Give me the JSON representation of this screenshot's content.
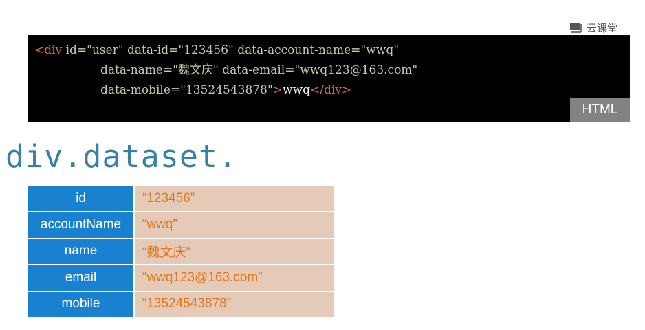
{
  "brand": {
    "name": "云课堂",
    "icon": "cloud-classroom-icon"
  },
  "code": {
    "language": "HTML",
    "line1": {
      "open": "<div",
      "attrs": " id=\"user\" data-id=\"123456\" data-account-name=\"wwq\""
    },
    "line2": "data-name=\"魏文庆\" data-email=\"wwq123@163.com\"",
    "line3": {
      "attrs": "data-mobile=\"13524543878\"",
      "gt": ">",
      "text": "wwq",
      "close": "</div>"
    }
  },
  "expression": "div.dataset.",
  "dataset": [
    {
      "key": "id",
      "value": "“123456”"
    },
    {
      "key": "accountName",
      "value": "“wwq”"
    },
    {
      "key": "name",
      "value": "“魏文庆”"
    },
    {
      "key": "email",
      "value": "“wwq123@163.com”"
    },
    {
      "key": "mobile",
      "value": "“13524543878”"
    }
  ],
  "colors": {
    "code_background": "#000000",
    "tag": "#d66a55",
    "key_cell": "#1a80d0",
    "value_cell": "#e5cab7",
    "value_text": "#e0741a",
    "expression_text": "#3a7fa8"
  }
}
